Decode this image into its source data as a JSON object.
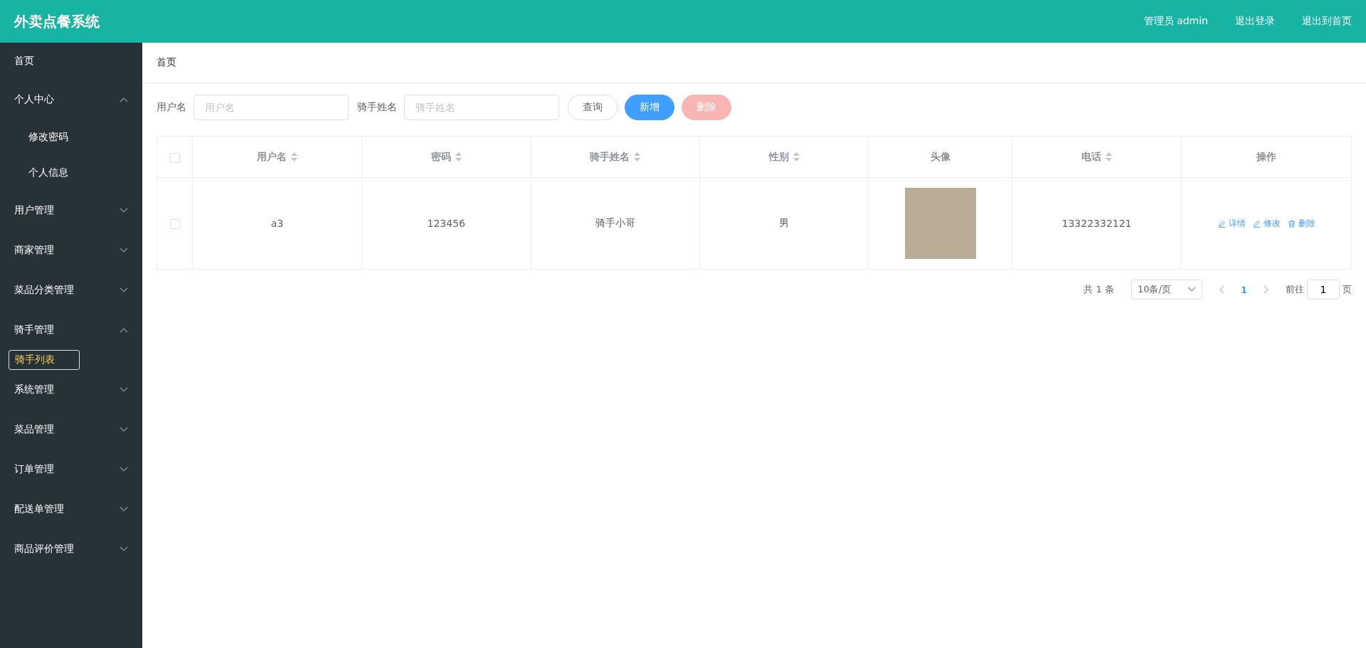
{
  "header": {
    "title": "外卖点餐系统",
    "links": [
      "管理员 admin",
      "退出登录",
      "退出到首页"
    ]
  },
  "sidebar": {
    "items": [
      {
        "kind": "link",
        "label": "首页",
        "selected": false
      },
      {
        "kind": "submenu",
        "label": "个人中心",
        "expanded": true,
        "children": [
          {
            "label": "修改密码",
            "selected": false
          },
          {
            "label": "个人信息",
            "selected": false
          }
        ]
      },
      {
        "kind": "submenu",
        "label": "用户管理",
        "expanded": false
      },
      {
        "kind": "submenu",
        "label": "商家管理",
        "expanded": false
      },
      {
        "kind": "submenu",
        "label": "菜品分类管理",
        "expanded": false
      },
      {
        "kind": "submenu",
        "label": "骑手管理",
        "expanded": true,
        "children": [
          {
            "label": "骑手列表",
            "selected": true
          }
        ]
      },
      {
        "kind": "submenu",
        "label": "系统管理",
        "expanded": false
      },
      {
        "kind": "submenu",
        "label": "菜品管理",
        "expanded": false
      },
      {
        "kind": "submenu",
        "label": "订单管理",
        "expanded": false
      },
      {
        "kind": "submenu",
        "label": "配送单管理",
        "expanded": false
      },
      {
        "kind": "submenu",
        "label": "商品评价管理",
        "expanded": false
      }
    ]
  },
  "breadcrumb": "首页",
  "search": {
    "fields": [
      {
        "label": "用户名",
        "placeholder": "用户名"
      },
      {
        "label": "骑手姓名",
        "placeholder": "骑手姓名"
      }
    ],
    "buttons": [
      {
        "kind": "plain",
        "label": "查询",
        "disabled": false
      },
      {
        "kind": "primary",
        "label": "新增",
        "disabled": false
      },
      {
        "kind": "danger",
        "label": "删除",
        "disabled": true
      }
    ]
  },
  "table": {
    "columns": [
      {
        "label": "用户名",
        "sortable": true
      },
      {
        "label": "密码",
        "sortable": true
      },
      {
        "label": "骑手姓名",
        "sortable": true
      },
      {
        "label": "性别",
        "sortable": true
      },
      {
        "label": "头像",
        "sortable": false
      },
      {
        "label": "电话",
        "sortable": true
      },
      {
        "label": "操作",
        "sortable": false
      }
    ],
    "rows": [
      {
        "checked": false,
        "username": "a3",
        "password": "123456",
        "name": "骑手小哥",
        "gender": "男",
        "phone": "13322332121",
        "actions": [
          {
            "kind": "edit",
            "label": "详情"
          },
          {
            "kind": "edit",
            "label": "修改"
          },
          {
            "kind": "delete",
            "label": "删除"
          }
        ]
      }
    ],
    "header_checked": false
  },
  "pagination": {
    "total": "共 1 条",
    "page_size": "10条/页",
    "pages": [
      {
        "label": "1",
        "selected": true
      }
    ],
    "goto_label": "前往",
    "goto_value": "1",
    "goto_suffix": "页"
  }
}
